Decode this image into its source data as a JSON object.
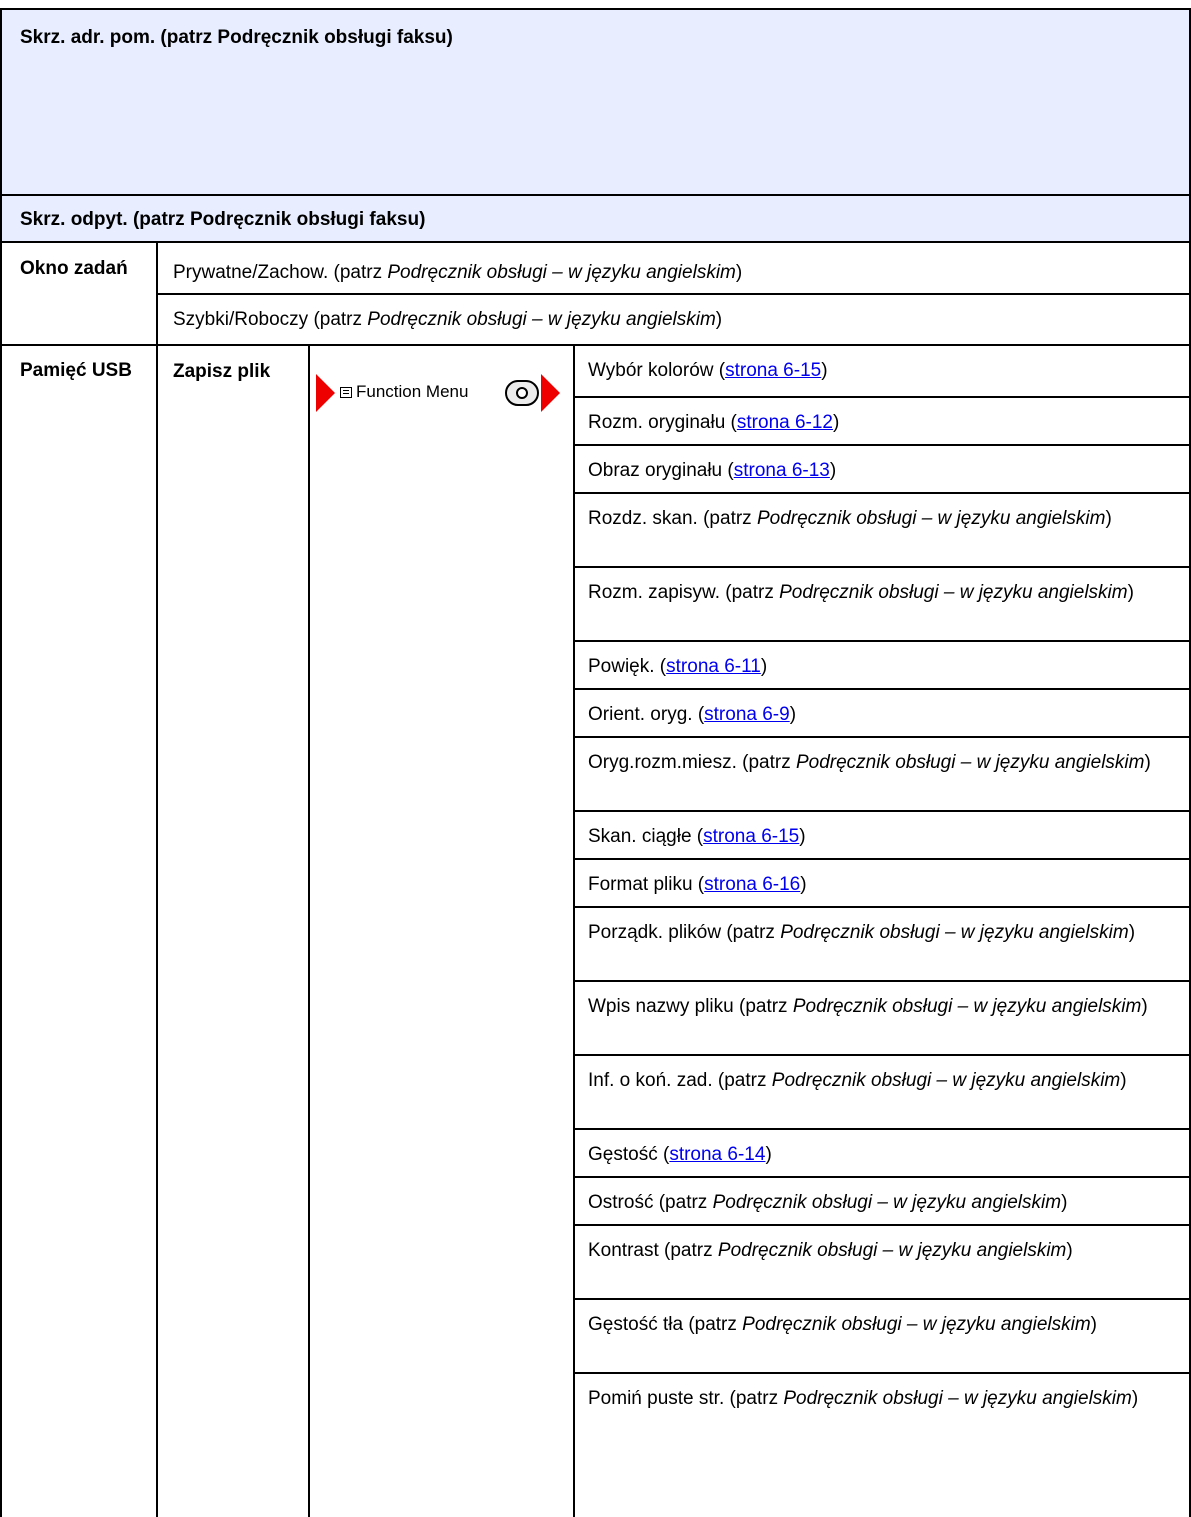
{
  "headers": {
    "abbr_address_book": "Skrz. adr. pom. (patrz Podręcznik obsługi faksu)",
    "abbr_polling": "Skrz. odpyt. (patrz Podręcznik obsługi faksu)"
  },
  "job_box": {
    "label": "Okno zadań",
    "rows": [
      {
        "text": "Prywatne/Zachow. (patrz ",
        "italic": "Podręcznik obsługi – w języku angielskim",
        "tail": ")"
      },
      {
        "text": "Szybki/Roboczy (patrz ",
        "italic": "Podręcznik obsługi – w języku angielskim",
        "tail": ")"
      }
    ]
  },
  "usb": {
    "label": "Pamięć USB",
    "sub_label": "Zapisz plik",
    "function_menu_label": "Function Menu",
    "items": [
      {
        "text": "Wybór kolorów (",
        "link": "strona 6-15",
        "tail": ")"
      },
      {
        "text": "Rozm. oryginału (",
        "link": "strona 6-12",
        "tail": ")"
      },
      {
        "text": "Obraz oryginału (",
        "link": "strona 6-13",
        "tail": ")"
      },
      {
        "text": "Rozdz. skan. (patrz ",
        "italic": "Podręcznik obsługi – w języku angielskim",
        "tail": ")"
      },
      {
        "text": "Rozm. zapisyw. (patrz ",
        "italic": "Podręcznik obsługi – w języku angielskim",
        "tail": ")"
      },
      {
        "text": "Powięk. (",
        "link": "strona 6-11",
        "tail": ")"
      },
      {
        "text": "Orient. oryg. (",
        "link": "strona 6-9",
        "tail": ")"
      },
      {
        "text": "Oryg.rozm.miesz. (patrz ",
        "italic": "Podręcznik obsługi – w języku angielskim",
        "tail": ")"
      },
      {
        "text": "Skan. ciągłe (",
        "link": "strona 6-15",
        "tail": ")"
      },
      {
        "text": "Format pliku (",
        "link": "strona 6-16",
        "tail": ")"
      },
      {
        "text": "Porządk. plików (patrz ",
        "italic": "Podręcznik obsługi – w języku angielskim",
        "tail": ")"
      },
      {
        "text": "Wpis nazwy pliku (patrz ",
        "italic": "Podręcznik obsługi – w języku angielskim",
        "tail": ")"
      },
      {
        "text": "Inf. o koń. zad. (patrz ",
        "italic": "Podręcznik obsługi – w języku angielskim",
        "tail": ")"
      },
      {
        "text": "Gęstość (",
        "link": "strona 6-14",
        "tail": ")"
      },
      {
        "text": "Ostrość (patrz ",
        "italic": "Podręcznik obsługi – w języku angielskim",
        "tail": ")"
      },
      {
        "text": "Kontrast (patrz ",
        "italic": "Podręcznik obsługi – w języku angielskim",
        "tail": ")"
      },
      {
        "text": "Gęstość tła (patrz ",
        "italic": "Podręcznik obsługi – w języku angielskim",
        "tail": ")"
      },
      {
        "text": "Pomiń puste str. (patrz ",
        "italic": "Podręcznik obsługi – w języku angielskim",
        "tail": ")"
      }
    ]
  },
  "colors": {
    "header_bg": "#e8eeff",
    "arrow": "#ee0000",
    "link": "#0000ee"
  }
}
